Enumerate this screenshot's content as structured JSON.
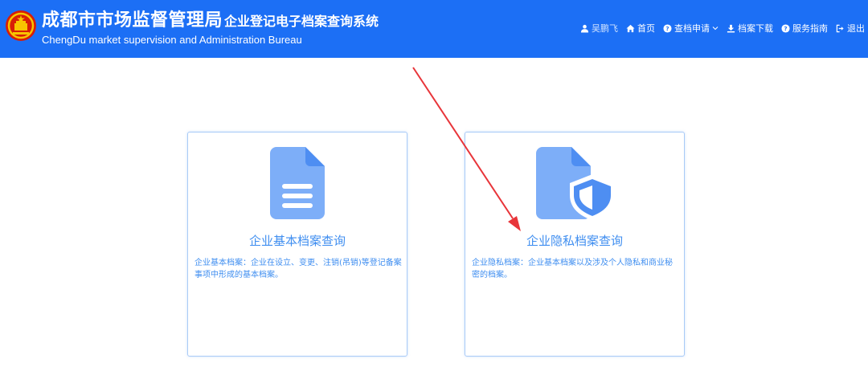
{
  "header": {
    "title_main": "成都市市场监督管理局",
    "title_sub": "企业登记电子档案查询系统",
    "title_en": "ChengDu market supervision and Administration Bureau",
    "bg_color": "#1c6ff5"
  },
  "nav": {
    "user": "吴鹏飞",
    "home": "首页",
    "apply": "查档申请",
    "download": "档案下载",
    "guide": "服务指南",
    "logout": "退出"
  },
  "cards": [
    {
      "title": "企业基本档案查询",
      "desc": "企业基本档案：企业在设立、变更、注销(吊销)等登记备案事项中形成的基本档案。",
      "icon": "document-icon"
    },
    {
      "title": "企业隐私档案查询",
      "desc": "企业隐私档案：企业基本档案以及涉及个人隐私和商业秘密的档案。",
      "icon": "shield-document-icon"
    }
  ],
  "colors": {
    "accent": "#1c6ff5",
    "card_text": "#3f8ef0",
    "icon_fill": "#7daef8",
    "annotation_arrow": "#e8353a"
  }
}
